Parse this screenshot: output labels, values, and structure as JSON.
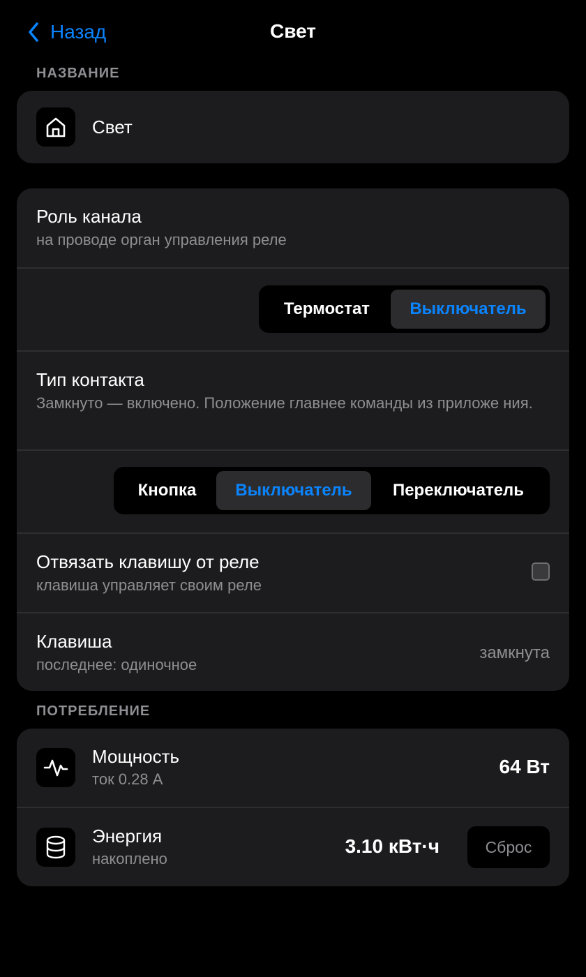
{
  "nav": {
    "back_label": "Назад",
    "title": "Свет"
  },
  "name_section": {
    "header": "НАЗВАНИЕ",
    "icon": "home-icon",
    "name": "Свет"
  },
  "channel": {
    "role_title": "Роль канала",
    "role_subtitle": "на проводе орган управления реле",
    "role_options": [
      "Термостат",
      "Выключатель"
    ],
    "role_selected": "Выключатель",
    "contact_title": "Тип контакта",
    "contact_subtitle": "Замкнуто — включено. Положение главнее команды из приложе ния.",
    "contact_options": [
      "Кнопка",
      "Выключатель",
      "Переключатель"
    ],
    "contact_selected": "Выключатель",
    "detach_title": "Отвязать клавишу от реле",
    "detach_subtitle": "клавиша управляет своим реле",
    "detach_checked": false,
    "key_title": "Клавиша",
    "key_subtitle": "последнее: одиночное",
    "key_state": "замкнута"
  },
  "consumption": {
    "header": "ПОТРЕБЛЕНИЕ",
    "power_icon": "activity-pulse-icon",
    "power_title": "Мощность",
    "power_subtitle": "ток 0.28 А",
    "power_value": "64 Вт",
    "energy_icon": "database-icon",
    "energy_title": "Энергия",
    "energy_subtitle": "накоплено",
    "energy_value": "3.10 кВт·ч",
    "reset_label": "Сброс"
  },
  "colors": {
    "accent": "#0a84ff",
    "background": "#000000",
    "card": "#1c1c1e",
    "secondary_text": "#8e8e93"
  }
}
